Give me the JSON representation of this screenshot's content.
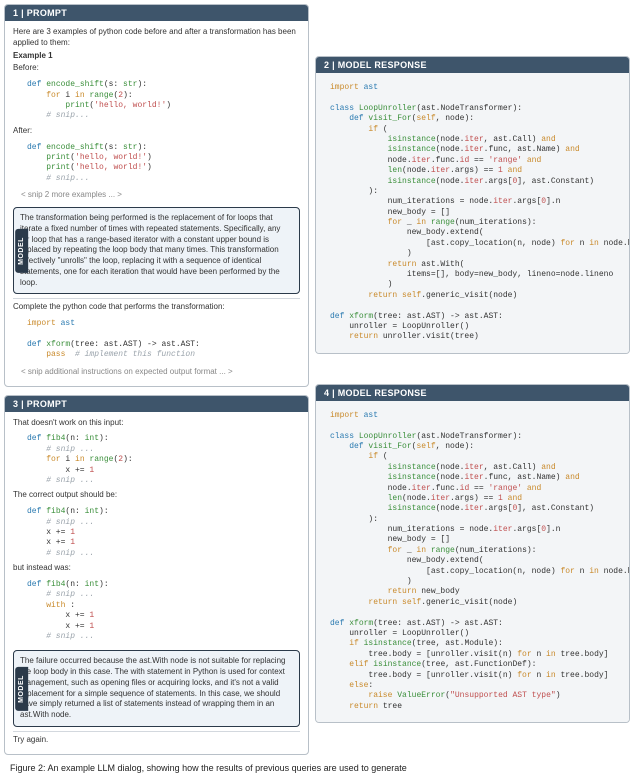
{
  "panel1": {
    "header": "1 | PROMPT",
    "intro": "Here are 3 examples of python code before and after a transformation has been applied to them:",
    "ex_label": "Example 1",
    "before_label": "Before:",
    "after_label": "After:",
    "code_before": "  def encode_shift(s: str):\n      for i in range(2):\n          print('hello, world!')\n      # snip...",
    "code_after": "  def encode_shift(s: str):\n      print('hello, world!')\n      print('hello, world!')\n      # snip...",
    "snip_examples": "< snip 2 more examples ... >",
    "model_desc": "The transformation being performed is the replacement of for loops that iterate a fixed number of times with repeated statements. Specifically, any for loop that has a range-based iterator with a constant upper bound is replaced by repeating the loop body that many times. This transformation effectively \"unrolls\" the loop, replacing it with a sequence of identical statements, one for each iteration that would have been performed by the loop.",
    "instr_label": "Complete the python code that performs the transformation:",
    "code_stub": "import ast\n\ndef xform(tree: ast.AST) -> ast.AST:\n    pass  # implement this function",
    "snip_instr": "< snip additional instructions on expected output format ... >"
  },
  "panel2": {
    "header": "2 | MODEL RESPONSE",
    "code": "import ast\n\nclass LoopUnroller(ast.NodeTransformer):\n    def visit_For(self, node):\n        if (\n            isinstance(node.iter, ast.Call) and\n            isinstance(node.iter.func, ast.Name) and\n            node.iter.func.id == 'range' and\n            len(node.iter.args) == 1 and\n            isinstance(node.iter.args[0], ast.Constant)\n        ):\n            num_iterations = node.iter.args[0].n\n            new_body = []\n            for _ in range(num_iterations):\n                new_body.extend(\n                    [ast.copy_location(n, node) for n in node.body]\n                )\n            return ast.With(\n                items=[], body=new_body, lineno=node.lineno\n            )\n        return self.generic_visit(node)\n\ndef xform(tree: ast.AST) -> ast.AST:\n    unroller = LoopUnroller()\n    return unroller.visit(tree)"
  },
  "panel3": {
    "header": "3 | PROMPT",
    "fail_intro": "That doesn't work on this input:",
    "code_input": "  def fib4(n: int):\n      # snip ...\n      for i in range(2):\n          x += 1\n      # snip ...",
    "correct_label": "The correct output should be:",
    "code_correct": "  def fib4(n: int):\n      # snip ...\n      x += 1\n      x += 1\n      # snip ...",
    "instead_label": "but instead was:",
    "code_instead": "  def fib4(n: int):\n      # snip ...\n      with :\n          x += 1\n          x += 1\n      # snip ...",
    "model_desc": "The failure occurred because the ast.With node is not suitable for replacing the loop body in this case. The with statement in Python is used for context management, such as opening files or acquiring locks, and it's not a valid replacement for a simple sequence of statements. In this case, we should have simply returned a list of statements instead of wrapping them in an ast.With node.",
    "try_again": "Try again."
  },
  "panel4": {
    "header": "4 | MODEL RESPONSE",
    "code": "import ast\n\nclass LoopUnroller(ast.NodeTransformer):\n    def visit_For(self, node):\n        if (\n            isinstance(node.iter, ast.Call) and\n            isinstance(node.iter.func, ast.Name) and\n            node.iter.func.id == 'range' and\n            len(node.iter.args) == 1 and\n            isinstance(node.iter.args[0], ast.Constant)\n        ):\n            num_iterations = node.iter.args[0].n\n            new_body = []\n            for _ in range(num_iterations):\n                new_body.extend(\n                    [ast.copy_location(n, node) for n in node.body]\n                )\n            return new_body\n        return self.generic_visit(node)\n\ndef xform(tree: ast.AST) -> ast.AST:\n    unroller = LoopUnroller()\n    if isinstance(tree, ast.Module):\n        tree.body = [unroller.visit(n) for n in tree.body]\n    elif isinstance(tree, ast.FunctionDef):\n        tree.body = [unroller.visit(n) for n in tree.body]\n    else:\n        raise ValueError(\"Unsupported AST type\")\n    return tree"
  },
  "caption": "Figure 2: An example LLM dialog, showing how the results of previous queries are used to generate",
  "model_label": "MODEL"
}
